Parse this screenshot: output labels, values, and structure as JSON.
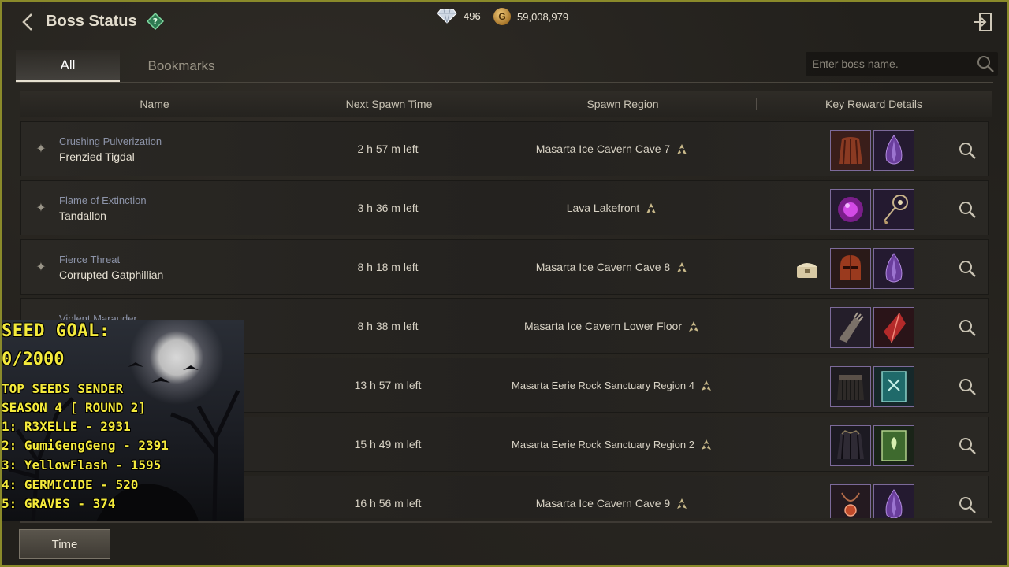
{
  "header": {
    "title": "Boss Status",
    "gems": "496",
    "gold": "59,008,979",
    "gold_icon_letter": "G"
  },
  "tabs": [
    {
      "label": "All",
      "active": true
    },
    {
      "label": "Bookmarks",
      "active": false
    }
  ],
  "search": {
    "placeholder": "Enter boss name."
  },
  "columns": [
    "Name",
    "Next Spawn Time",
    "Spawn Region",
    "Key Reward Details"
  ],
  "rows": [
    {
      "subtitle": "Crushing Pulverization",
      "name": "Frenzied Tigdal",
      "time": "2 h 57 m left",
      "region": "Masarta Ice Cavern Cave 7",
      "rewards": [
        "cloak-reward-icon",
        "purple-gem-reward-icon"
      ],
      "chest": false
    },
    {
      "subtitle": "Flame of Extinction",
      "name": "Tandallon",
      "time": "3 h 36 m left",
      "region": "Lava Lakefront",
      "rewards": [
        "purple-orb-reward-icon",
        "amulet-reward-icon"
      ],
      "chest": false
    },
    {
      "subtitle": "Fierce Threat",
      "name": "Corrupted Gatphillian",
      "time": "8 h 18 m left",
      "region": "Masarta Ice Cavern Cave 8",
      "rewards": [
        "helmet-reward-icon",
        "purple-gem-reward-icon"
      ],
      "chest": true
    },
    {
      "subtitle": "Violent Marauder",
      "name": "",
      "time": "8 h 38 m left",
      "region": "Masarta Ice Cavern Lower Floor",
      "rewards": [
        "gauntlet-reward-icon",
        "red-crystal-reward-icon"
      ],
      "chest": false
    },
    {
      "subtitle": "",
      "name": "",
      "time": "13 h 57 m left",
      "region": "Masarta Eerie Rock Sanctuary Region 4",
      "rewards": [
        "skirt-armor-reward-icon",
        "teal-book-reward-icon"
      ],
      "chest": false
    },
    {
      "subtitle": "",
      "name": "",
      "time": "15 h 49 m left",
      "region": "Masarta Eerie Rock Sanctuary Region 2",
      "rewards": [
        "dark-cloak-reward-icon",
        "green-book-reward-icon"
      ],
      "chest": false
    },
    {
      "subtitle": "",
      "name": "",
      "time": "16 h 56 m left",
      "region": "Masarta Ice Cavern Cave 9",
      "rewards": [
        "necklace-reward-icon",
        "purple-gem-reward-icon"
      ],
      "chest": false
    }
  ],
  "overlay": {
    "goal_label": "SEED GOAL:",
    "goal_count": "0/2000",
    "lines": [
      "TOP SEEDS SENDER",
      "SEASON 4 [ ROUND 2]",
      "1: R3XELLE - 2931",
      "2: GumiGengGeng - 2391",
      "3: YellowFlash - 1595",
      "4: GERMICIDE - 520",
      "5: GRAVES - 374"
    ]
  },
  "footer": {
    "time_button": "Time"
  },
  "colors": {
    "accent_text": "#8c93a8",
    "overlay_text": "#f4ea3c",
    "reward_border": "#7c6a9a"
  }
}
